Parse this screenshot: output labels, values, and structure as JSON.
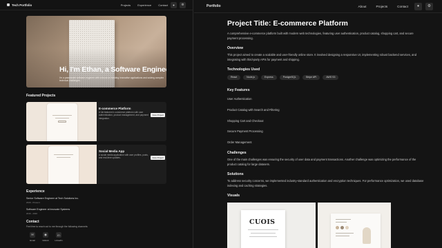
{
  "left_page": {
    "nav": {
      "brand": "Tech Portfolio",
      "links": [
        "Projects",
        "Experience",
        "Contact"
      ],
      "icons": [
        "bell-icon",
        "settings-icon"
      ]
    },
    "hero": {
      "title": "Hi, I'm Ethan, a Software Engineer",
      "subtitle": "I'm a passionate software engineer with a focus on building innovative applications and solving complex technical challenges."
    },
    "featured_title": "Featured Projects",
    "projects": [
      {
        "title": "E-commerce Platform",
        "description": "A full-featured e-commerce platform with user authentication, product management, and payment integration.",
        "button": "View Project",
        "thumb_caption": "CUOIS"
      },
      {
        "title": "Social Media App",
        "description": "A social media application with user profiles, posts, and real-time updates.",
        "button": "View Project"
      }
    ],
    "experience_title": "Experience",
    "experience": [
      {
        "title": "Senior Software Engineer at Tech Solutions Inc.",
        "dates": "2020 - Present"
      },
      {
        "title": "Software Engineer at Innovate Systems",
        "dates": "2016 - 2020"
      }
    ],
    "contact_title": "Contact",
    "contact_text": "Feel free to reach out to me through the following channels:",
    "contact_items": [
      {
        "label": "Email",
        "icon": "mail-icon"
      },
      {
        "label": "GitHub",
        "icon": "github-icon"
      },
      {
        "label": "LinkedIn",
        "icon": "linkedin-icon"
      }
    ]
  },
  "right_page": {
    "nav": {
      "brand": "Portfolio",
      "links": [
        "About",
        "Projects",
        "Contact"
      ],
      "icons": [
        "bell-icon",
        "settings-icon"
      ]
    },
    "title": "Project Title: E-commerce Platform",
    "intro": "A comprehensive e-commerce platform built with modern web technologies, featuring user authentication, product catalog, shopping cart, and secure payment processing.",
    "overview_title": "Overview",
    "overview_text": "This project aimed to create a scalable and user-friendly online store. It involved designing a responsive UI, implementing robust backend services, and integrating with third-party APIs for payment and shipping.",
    "tech_title": "Technologies Used",
    "technologies": [
      "React",
      "Node.js",
      "Express",
      "PostgreSQL",
      "Stripe API",
      "AWS S3"
    ],
    "features_title": "Key Features",
    "features": [
      "User Authentication",
      "Product Catalog with Search and Filtering",
      "Shopping Cart and Checkout",
      "Secure Payment Processing",
      "Order Management"
    ],
    "challenges_title": "Challenges",
    "challenges_text": "One of the main challenges was ensuring the security of user data and payment transactions. Another challenge was optimizing the performance of the product catalog for large datasets.",
    "solutions_title": "Solutions",
    "solutions_text": "To address security concerns, we implemented industry-standard authentication and encryption techniques. For performance optimization, we used database indexing and caching strategies.",
    "visuals_title": "Visuals",
    "visual_logo": "CUOIS"
  }
}
